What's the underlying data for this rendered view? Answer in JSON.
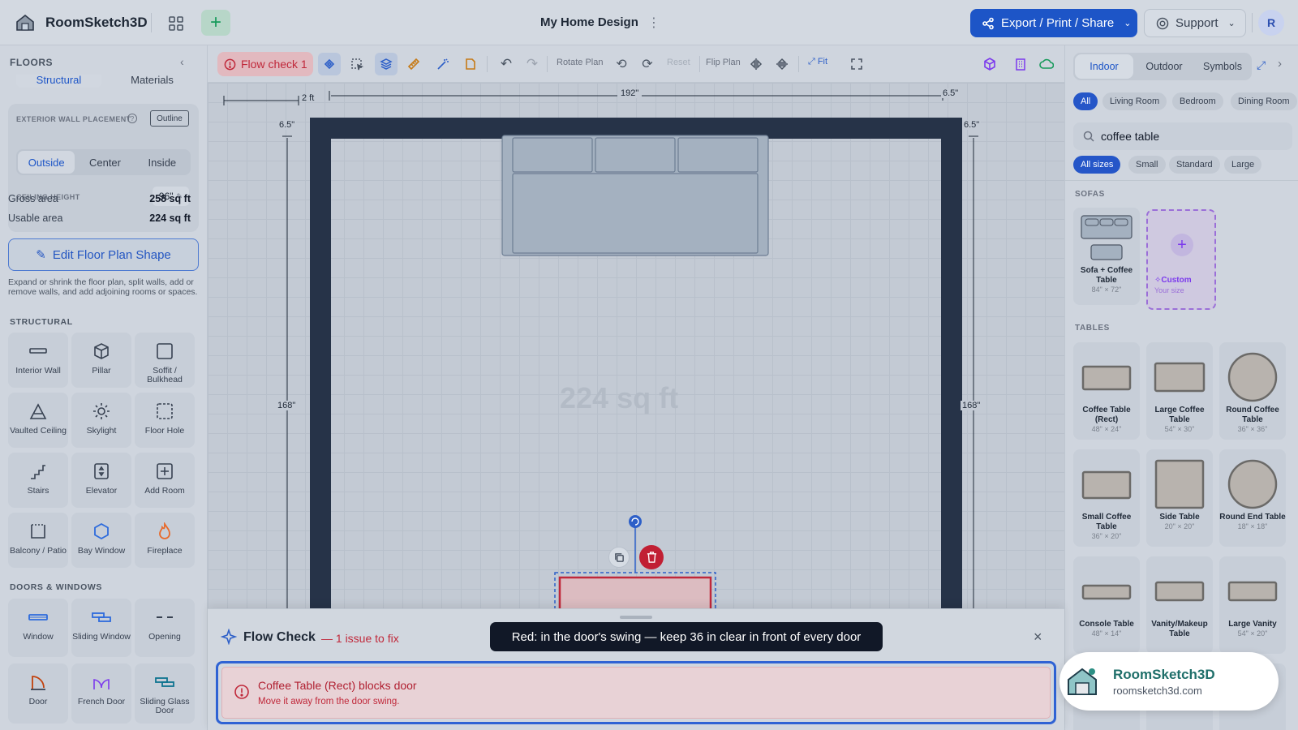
{
  "app": {
    "name": "RoomSketch3D",
    "doc_title": "My Home Design",
    "avatar": "R"
  },
  "header": {
    "export_label": "Export / Print / Share",
    "support_label": "Support"
  },
  "left_panel": {
    "title": "FLOORS",
    "tabs": [
      "Structural",
      "Materials"
    ],
    "wall_placement_label": "EXTERIOR WALL PLACEMENT",
    "outline_label": "Outline",
    "placement_options": [
      "Outside",
      "Center",
      "Inside"
    ],
    "ceiling_label": "CEILING HEIGHT",
    "ceiling_value": "96\"",
    "gross_label": "Gross area",
    "gross_value": "258 sq ft",
    "usable_label": "Usable area",
    "usable_value": "224 sq ft",
    "edit_label": "Edit Floor Plan Shape",
    "help_text": "Expand or shrink the floor plan, split walls, add or remove walls, and add adjoining rooms or spaces.",
    "structural_heading": "STRUCTURAL",
    "structural_items": [
      "Interior Wall",
      "Pillar",
      "Soffit / Bulkhead",
      "Vaulted Ceiling",
      "Skylight",
      "Floor Hole",
      "Stairs",
      "Elevator",
      "Add Room",
      "Balcony / Patio",
      "Bay Window",
      "Fireplace"
    ],
    "doors_heading": "DOORS & WINDOWS",
    "door_items": [
      "Window",
      "Sliding Window",
      "Opening",
      "Door",
      "French Door",
      "Sliding Glass Door"
    ]
  },
  "toolbar": {
    "flow_check_label": "Flow check 1",
    "rotate_label": "Rotate Plan",
    "reset_label": "Reset",
    "flip_label": "Flip Plan",
    "fit_label": "Fit"
  },
  "canvas": {
    "scale_label": "2 ft",
    "dim_top": "192\"",
    "dim_corner": "6.5\"",
    "dim_side": "168\"",
    "area_watermark": "224 sq ft"
  },
  "right_panel": {
    "tabs": [
      "Indoor",
      "Outdoor",
      "Symbols"
    ],
    "room_filters": [
      "All",
      "Living Room",
      "Bedroom",
      "Dining Room"
    ],
    "search_value": "coffee table",
    "size_filters": [
      "All sizes",
      "Small",
      "Standard",
      "Large"
    ],
    "sofas_heading": "SOFAS",
    "sofa_item": {
      "name": "Sofa + Coffee Table",
      "size": "84\" × 72\""
    },
    "custom_item": {
      "name": "Custom",
      "sub": "Your size"
    },
    "tables_heading": "TABLES",
    "tables": [
      {
        "name": "Coffee Table (Rect)",
        "size": "48\" × 24\""
      },
      {
        "name": "Large Coffee Table",
        "size": "54\" × 30\""
      },
      {
        "name": "Round Coffee Table",
        "size": "36\" × 36\""
      },
      {
        "name": "Small Coffee Table",
        "size": "36\" × 20\""
      },
      {
        "name": "Side Table",
        "size": "20\" × 20\""
      },
      {
        "name": "Round End Table",
        "size": "18\" × 18\""
      },
      {
        "name": "Console Table",
        "size": "48\" × 14\""
      },
      {
        "name": "Vanity/Makeup Table",
        "size": ""
      },
      {
        "name": "Large Vanity",
        "size": "54\" × 20\""
      }
    ]
  },
  "flow_check": {
    "title": "Flow Check",
    "count": "— 1 issue to fix",
    "issue_title": "Coffee Table (Rect) blocks door",
    "issue_desc": "Move it away from the door swing.",
    "tooltip": "Red: in the door's swing — keep 36 in clear in front of every door"
  },
  "brand_badge": {
    "name": "RoomSketch3D",
    "url": "roomsketch3d.com"
  },
  "colors": {
    "accent": "#1d55c7",
    "error": "#c0283a",
    "wall": "#263348",
    "add": "#169a5a"
  }
}
